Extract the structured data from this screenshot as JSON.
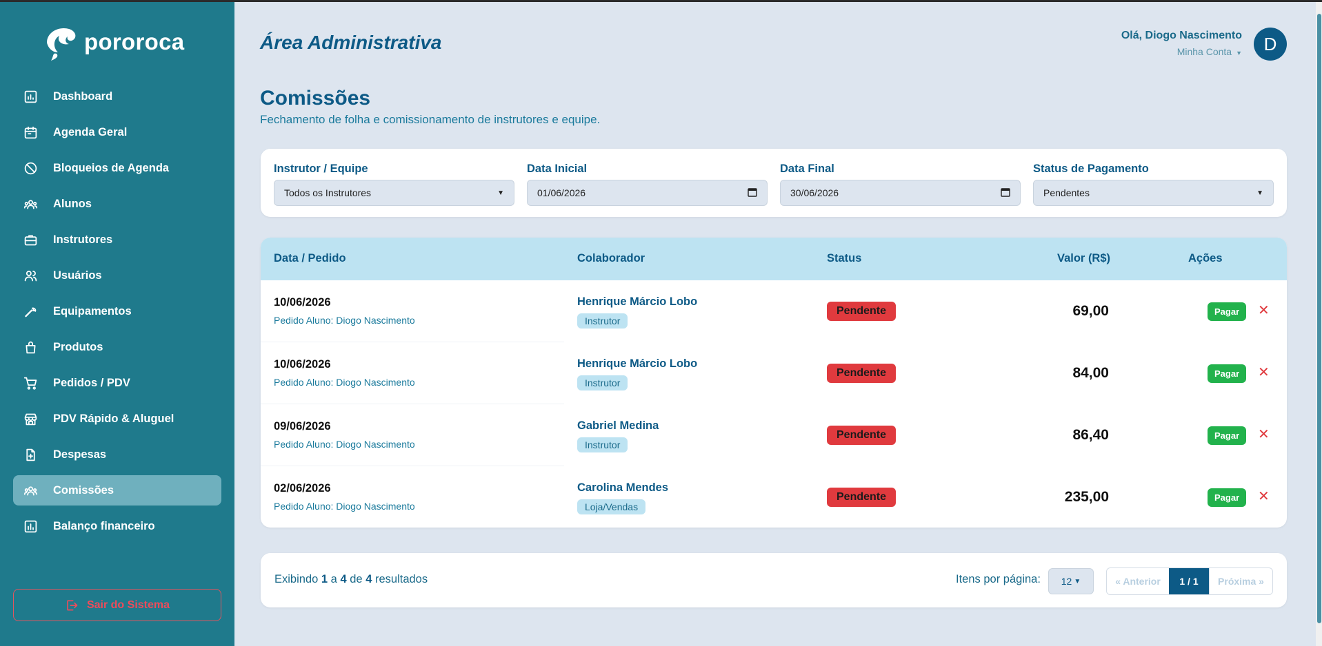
{
  "brand": {
    "name": "pororoca"
  },
  "sidebar": {
    "items": [
      {
        "label": "Dashboard",
        "icon": "dashboard-icon"
      },
      {
        "label": "Agenda Geral",
        "icon": "calendar-icon"
      },
      {
        "label": "Bloqueios de Agenda",
        "icon": "block-icon"
      },
      {
        "label": "Alunos",
        "icon": "students-icon"
      },
      {
        "label": "Instrutores",
        "icon": "briefcase-icon"
      },
      {
        "label": "Usuários",
        "icon": "users-icon"
      },
      {
        "label": "Equipamentos",
        "icon": "wrench-icon"
      },
      {
        "label": "Produtos",
        "icon": "bag-icon"
      },
      {
        "label": "Pedidos / PDV",
        "icon": "cart-icon"
      },
      {
        "label": "PDV Rápido & Aluguel",
        "icon": "store-icon"
      },
      {
        "label": "Despesas",
        "icon": "file-plus-icon"
      },
      {
        "label": "Comissões",
        "icon": "team-icon",
        "active": true
      },
      {
        "label": "Balanço financeiro",
        "icon": "chart-icon"
      }
    ],
    "logout_label": "Sair do Sistema"
  },
  "header": {
    "area_title": "Área Administrativa",
    "greeting": "Olá, Diogo Nascimento",
    "account_label": "Minha Conta",
    "avatar_letter": "D"
  },
  "page": {
    "title": "Comissões",
    "subtitle": "Fechamento de folha e comissionamento de instrutores e equipe."
  },
  "filters": {
    "instructor": {
      "label": "Instrutor / Equipe",
      "value": "Todos os Instrutores"
    },
    "start_date": {
      "label": "Data Inicial",
      "value": "01/06/2026"
    },
    "end_date": {
      "label": "Data Final",
      "value": "30/06/2026"
    },
    "payment_status": {
      "label": "Status de Pagamento",
      "value": "Pendentes"
    }
  },
  "table": {
    "columns": {
      "date": "Data / Pedido",
      "collaborator": "Colaborador",
      "status": "Status",
      "value": "Valor (R$)",
      "actions": "Ações"
    },
    "pay_label": "Pagar",
    "remove_symbol": "✕",
    "rows": [
      {
        "date": "10/06/2026",
        "order": "Pedido Aluno: Diogo Nascimento",
        "name": "Henrique Márcio Lobo",
        "role": "Instrutor",
        "status": "Pendente",
        "value": "69,00"
      },
      {
        "date": "10/06/2026",
        "order": "Pedido Aluno: Diogo Nascimento",
        "name": "Henrique Márcio Lobo",
        "role": "Instrutor",
        "status": "Pendente",
        "value": "84,00"
      },
      {
        "date": "09/06/2026",
        "order": "Pedido Aluno: Diogo Nascimento",
        "name": "Gabriel Medina",
        "role": "Instrutor",
        "status": "Pendente",
        "value": "86,40"
      },
      {
        "date": "02/06/2026",
        "order": "Pedido Aluno: Diogo Nascimento",
        "name": "Carolina Mendes",
        "role": "Loja/Vendas",
        "status": "Pendente",
        "value": "235,00"
      }
    ]
  },
  "pagination": {
    "prefix": "Exibindo",
    "from": "1",
    "sep1": "a",
    "to": "4",
    "sep2": "de",
    "total": "4",
    "suffix": "resultados",
    "per_page_label": "Itens por página:",
    "per_page_value": "12",
    "prev_label": "« Anterior",
    "current": "1 / 1",
    "next_label": "Próxima »"
  },
  "colors": {
    "sidebar_bg": "#1f7a8c",
    "primary": "#0d5a86",
    "pending": "#e03a3e",
    "pay": "#22b24c"
  }
}
